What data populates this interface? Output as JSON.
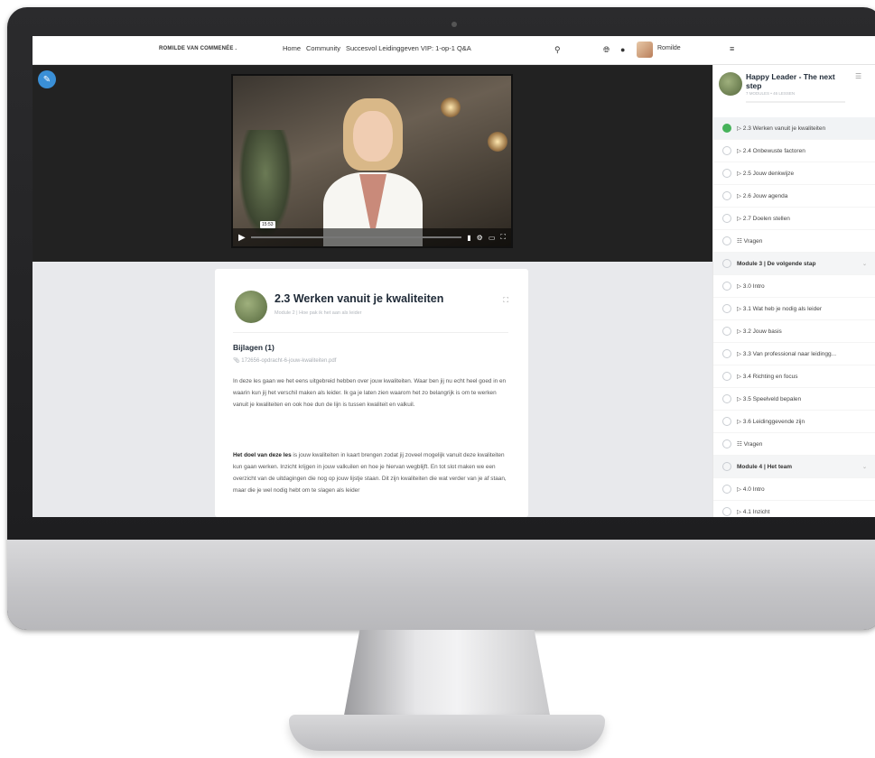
{
  "topbar": {
    "brand": "ROMILDE VAN COMMENÉE .",
    "nav": [
      "Home",
      "Community",
      "Succesvol Leidinggeven VIP: 1-op-1 Q&A"
    ],
    "username": "Romilde",
    "icons": [
      "search-icon",
      "globe-icon",
      "chat-icon",
      "menu-icon"
    ]
  },
  "video": {
    "timestamp": "15:53"
  },
  "lesson": {
    "title": "2.3 Werken vanuit je kwaliteiten",
    "subtitle": "Module 2 | Hoe pak ik het aan als leider",
    "attachments_title": "Bijlagen (1)",
    "attachment_file": "172656-opdracht-6-jouw-kwaliteiten.pdf",
    "para1": "In deze les gaan we het eens uitgebreid hebben over jouw kwaliteiten. Waar ben jij nu echt heel goed in en waarin kun jij het verschil maken als leider. Ik ga je laten zien waarom het zo belangrijk is om te werken vanuit je kwaliteiten en ook hoe dun de lijn is tussen kwaliteit en valkuil.",
    "para2_bold": "Het doel van deze les",
    "para2_rest": " is jouw kwaliteiten in kaart brengen zodat jij zoveel mogelijk vanuit deze kwaliteiten kun gaan werken. Inzicht krijgen in jouw valkuilen en hoe je hiervan wegblijft. En tot slot maken we een overzicht van de uitdagingen die nog op jouw lijstje staan. Dit zijn kwaliteiten die wat verder van je af staan, maar die je wel nodig hebt om te slagen als leider"
  },
  "sidebar": {
    "course_title": "Happy Leader - The next step",
    "course_meta": "7 MODULES • 46 LESSEN",
    "items": [
      {
        "label": "▷ 2.3 Werken vanuit je kwaliteiten",
        "state": "active"
      },
      {
        "label": "▷ 2.4 Onbewuste factoren",
        "state": "normal"
      },
      {
        "label": "▷ 2.5 Jouw denkwijze",
        "state": "normal"
      },
      {
        "label": "▷ 2.6 Jouw agenda",
        "state": "normal"
      },
      {
        "label": "▷ 2.7 Doelen stellen",
        "state": "normal"
      },
      {
        "label": "☷ Vragen",
        "state": "normal"
      },
      {
        "label": "Module 3 | De volgende stap",
        "state": "module"
      },
      {
        "label": "▷ 3.0 Intro",
        "state": "normal"
      },
      {
        "label": "▷ 3.1 Wat heb je nodig als leider",
        "state": "normal"
      },
      {
        "label": "▷ 3.2 Jouw basis",
        "state": "normal"
      },
      {
        "label": "▷ 3.3 Van professional naar leidingg...",
        "state": "normal"
      },
      {
        "label": "▷ 3.4 Richting en focus",
        "state": "normal"
      },
      {
        "label": "▷ 3.5 Speelveld bepalen",
        "state": "normal"
      },
      {
        "label": "▷ 3.6 Leidinggevende zijn",
        "state": "normal"
      },
      {
        "label": "☷ Vragen",
        "state": "normal"
      },
      {
        "label": "Module 4 | Het team",
        "state": "module"
      },
      {
        "label": "▷ 4.0 Intro",
        "state": "normal"
      },
      {
        "label": "▷ 4.1 Inzicht",
        "state": "normal"
      }
    ]
  }
}
